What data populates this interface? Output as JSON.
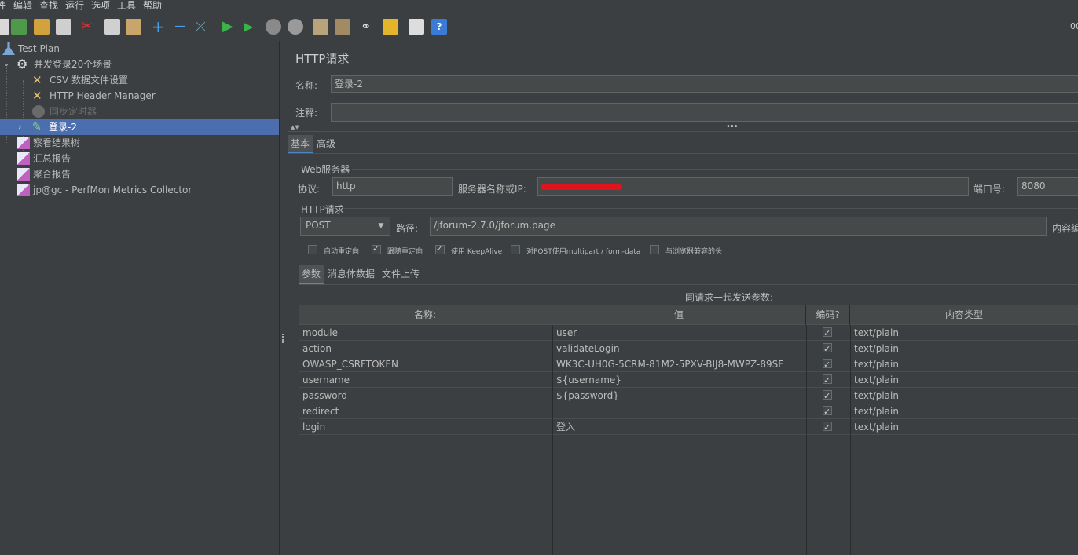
{
  "menu": [
    "件",
    "编辑",
    "查找",
    "运行",
    "选项",
    "工具",
    "帮助"
  ],
  "toolbar": {
    "buttons": [
      "template-icon",
      "open-icon",
      "open-folder-icon",
      "save-icon",
      "cut-icon",
      "copy-icon",
      "paste-icon",
      "add-icon",
      "remove-icon",
      "toggle-icon",
      "start-icon",
      "start-no-pause-icon",
      "stop-icon",
      "shutdown-icon",
      "clear-icon",
      "clear-all-icon",
      "search-icon",
      "reset-search-icon",
      "function-helper-icon",
      "help-icon"
    ],
    "right_text": "00"
  },
  "tree": [
    {
      "label": "Test Plan",
      "icon": "test-plan-icon"
    },
    {
      "label": "并发登录20个场景",
      "icon": "thread-group-gear-icon"
    },
    {
      "label": "CSV 数据文件设置",
      "icon": "config-tools-icon"
    },
    {
      "label": "HTTP Header Manager",
      "icon": "config-tools-icon"
    },
    {
      "label": "同步定时器",
      "icon": "timer-icon"
    },
    {
      "label": "登录-2",
      "icon": "sampler-pipette-icon"
    },
    {
      "label": "察看结果树",
      "icon": "listener-icon"
    },
    {
      "label": "汇总报告",
      "icon": "listener-icon"
    },
    {
      "label": "聚合报告",
      "icon": "listener-icon"
    },
    {
      "label": "jp@gc - PerfMon Metrics Collector",
      "icon": "listener-icon"
    }
  ],
  "panel": {
    "title": "HTTP请求",
    "name_label": "名称:",
    "name_value": "登录-2",
    "comment_label": "注释:",
    "comment_value": "",
    "tabs": [
      "基本",
      "高级"
    ],
    "web_server": {
      "section": "Web服务器",
      "protocol_label": "协议:",
      "protocol_value": "http",
      "server_label": "服务器名称或IP:",
      "server_value": "",
      "port_label": "端口号:",
      "port_value": "8080"
    },
    "http_request": {
      "section": "HTTP请求",
      "method": "POST",
      "path_label": "路径:",
      "path_value": "/jforum-2.7.0/jforum.page",
      "encoding_label": "内容编"
    },
    "options": [
      {
        "label": "自动重定向",
        "checked": false
      },
      {
        "label": "跟随重定向",
        "checked": true
      },
      {
        "label": "使用 KeepAlive",
        "checked": true
      },
      {
        "label": "对POST使用multipart / form-data",
        "checked": false
      },
      {
        "label": "与浏览器兼容的头",
        "checked": false
      }
    ],
    "sub_tabs": [
      "参数",
      "消息体数据",
      "文件上传"
    ],
    "params_caption": "同请求一起发送参数:",
    "columns": [
      "名称:",
      "值",
      "编码?",
      "内容类型"
    ],
    "rows": [
      {
        "name": "module",
        "value": "user",
        "encode": true,
        "type": "text/plain"
      },
      {
        "name": "action",
        "value": "validateLogin",
        "encode": true,
        "type": "text/plain"
      },
      {
        "name": "OWASP_CSRFTOKEN",
        "value": "WK3C-UH0G-5CRM-81M2-5PXV-BIJ8-MWPZ-89SE",
        "encode": true,
        "type": "text/plain"
      },
      {
        "name": "username",
        "value": "${username}",
        "encode": true,
        "type": "text/plain"
      },
      {
        "name": "password",
        "value": "${password}",
        "encode": true,
        "type": "text/plain"
      },
      {
        "name": "redirect",
        "value": "",
        "encode": true,
        "type": "text/plain"
      },
      {
        "name": "login",
        "value": "登入",
        "encode": true,
        "type": "text/plain"
      }
    ]
  },
  "colors": {
    "background": "#3c3f41",
    "selection": "#4b6eaf",
    "field": "#45494a",
    "redaction": "#e0141c"
  }
}
